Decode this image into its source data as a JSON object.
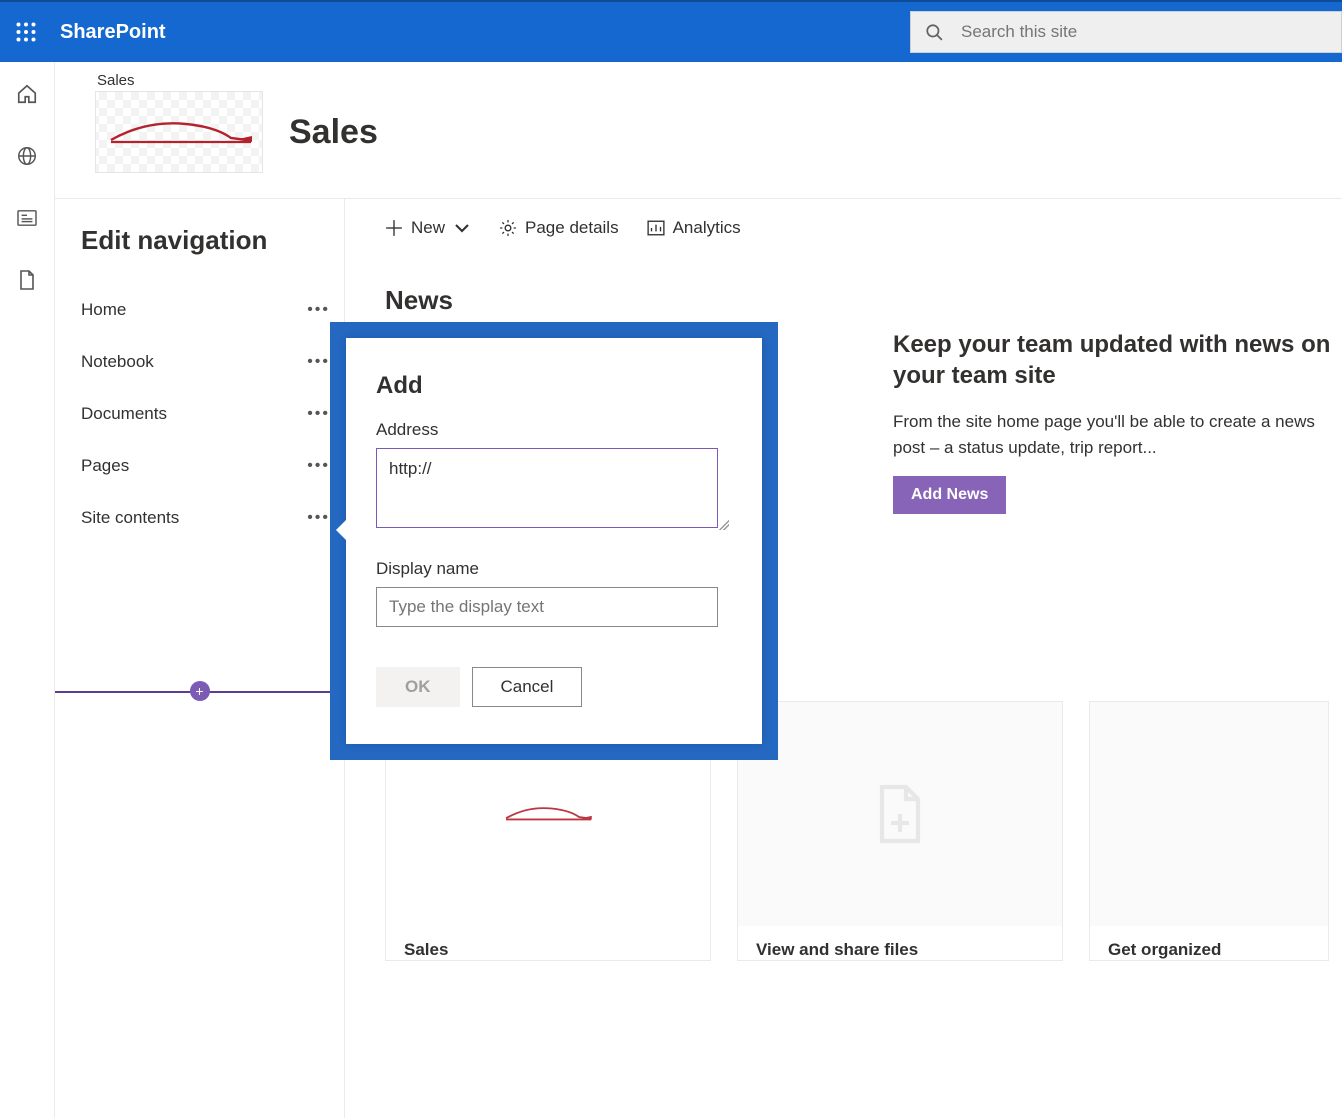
{
  "suite": {
    "app_name": "SharePoint"
  },
  "search": {
    "placeholder": "Search this site"
  },
  "site": {
    "breadcrumb": "Sales",
    "title": "Sales"
  },
  "nav_panel": {
    "heading": "Edit navigation",
    "items": [
      {
        "label": "Home"
      },
      {
        "label": "Notebook"
      },
      {
        "label": "Documents"
      },
      {
        "label": "Pages"
      },
      {
        "label": "Site contents"
      }
    ]
  },
  "cmdbar": {
    "new": "New",
    "page_details": "Page details",
    "analytics": "Analytics"
  },
  "news": {
    "heading": "News",
    "promo_title": "Keep your team updated with news on your team site",
    "promo_body": "From the site home page you'll be able to create a news post – a status update, trip report...",
    "add_button": "Add News"
  },
  "dialog": {
    "title": "Add",
    "address_label": "Address",
    "address_value": "http://",
    "display_label": "Display name",
    "display_placeholder": "Type the display text",
    "ok": "OK",
    "cancel": "Cancel"
  },
  "cards": [
    {
      "title": "Sales"
    },
    {
      "title": "View and share files"
    },
    {
      "title": "Get organized"
    }
  ]
}
